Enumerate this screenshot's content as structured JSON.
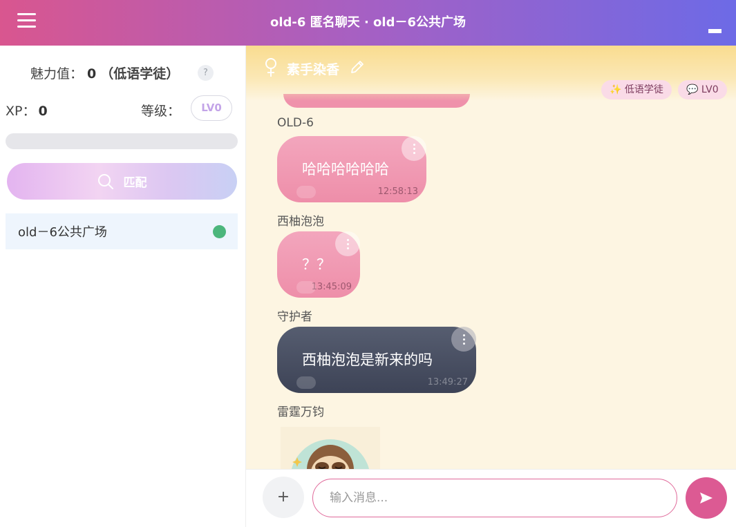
{
  "header": {
    "title": "old-6 匿名聊天 · old－6公共广场"
  },
  "profile": {
    "charm_label": "魅力值：",
    "charm_value": "0",
    "charm_rank": "（低语学徒）",
    "help": "?",
    "xp_label": "XP：",
    "xp_value": "0",
    "level_label": "等级：",
    "level_value": "LV0",
    "xp_progress": 0
  },
  "match_button": {
    "label": "匹配"
  },
  "rooms": [
    {
      "name": "old－6公共广场",
      "status": "online"
    }
  ],
  "chat": {
    "peer_name": "素手染香",
    "tags": {
      "rank": "✨ 低语学徒",
      "level": "💬 LV0"
    },
    "messages": [
      {
        "sender": "OLD-6",
        "text": "哈哈哈哈哈哈",
        "time": "12:58:13"
      },
      {
        "sender": "西柚泡泡",
        "text": "？？",
        "time": "13:45:09"
      },
      {
        "sender": "守护者",
        "text": "西柚泡泡是新来的吗",
        "time": "13:49:27"
      },
      {
        "sender": "雷霆万钧"
      }
    ]
  },
  "composer": {
    "placeholder": "输入消息...",
    "plus": "+"
  },
  "colors": {
    "accent": "#dc5a93",
    "online": "#4cb67c",
    "header_from": "#d9568f",
    "header_to": "#6d6ae6"
  },
  "icons": [
    "menu-icon",
    "minimize-icon",
    "help-icon",
    "search-icon",
    "female-icon",
    "pencil-icon",
    "more-icon",
    "plus-icon",
    "send-icon"
  ]
}
